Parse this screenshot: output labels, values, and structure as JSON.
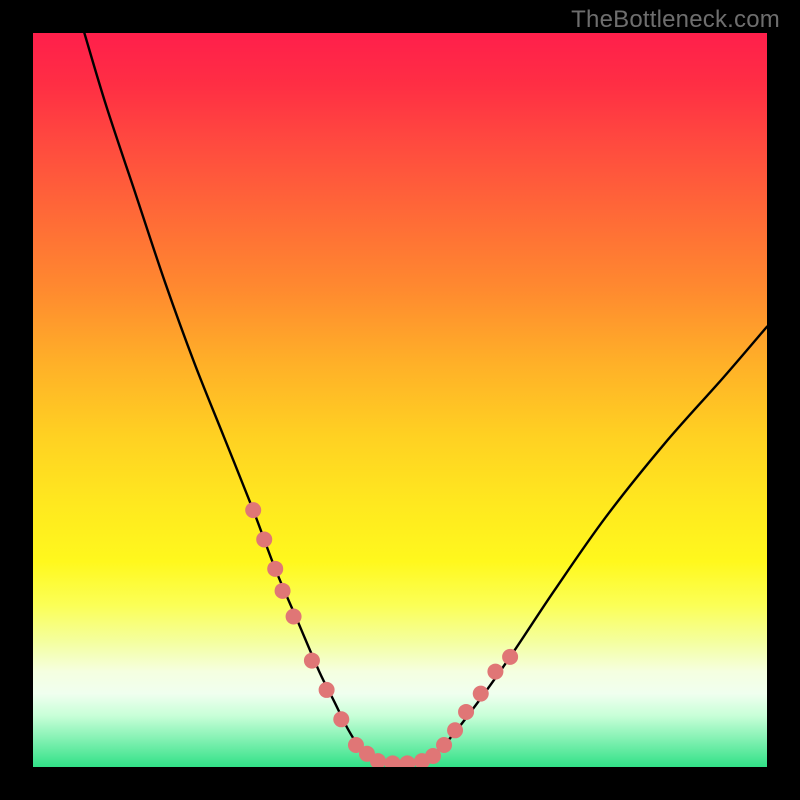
{
  "watermark": "TheBottleneck.com",
  "chart_data": {
    "type": "line",
    "title": "",
    "xlabel": "",
    "ylabel": "",
    "xlim": [
      0,
      100
    ],
    "ylim": [
      0,
      100
    ],
    "series": [
      {
        "name": "bottleneck-curve",
        "x": [
          7,
          10,
          14,
          18,
          22,
          26,
          30,
          33,
          36,
          39,
          41,
          43,
          45,
          47,
          49,
          51,
          53,
          56,
          60,
          65,
          71,
          78,
          86,
          94,
          100
        ],
        "values": [
          100,
          90,
          78,
          66,
          55,
          45,
          35,
          27,
          20,
          13,
          9,
          5,
          2,
          0.8,
          0.5,
          0.5,
          0.8,
          3,
          8,
          15,
          24,
          34,
          44,
          53,
          60
        ]
      }
    ],
    "markers": {
      "name": "highlight-points",
      "x": [
        30,
        31.5,
        33,
        34,
        35.5,
        38,
        40,
        42,
        44,
        45.5,
        47,
        49,
        51,
        53,
        54.5,
        56,
        57.5,
        59,
        61,
        63,
        65
      ],
      "values": [
        35,
        31,
        27,
        24,
        20.5,
        14.5,
        10.5,
        6.5,
        3,
        1.8,
        0.8,
        0.5,
        0.5,
        0.8,
        1.5,
        3,
        5,
        7.5,
        10,
        13,
        15
      ],
      "color": "#e07676",
      "radius": 8
    },
    "background_gradient": {
      "top": "#ff1f4b",
      "mid": "#ffe81f",
      "bottom": "#31e187"
    }
  }
}
